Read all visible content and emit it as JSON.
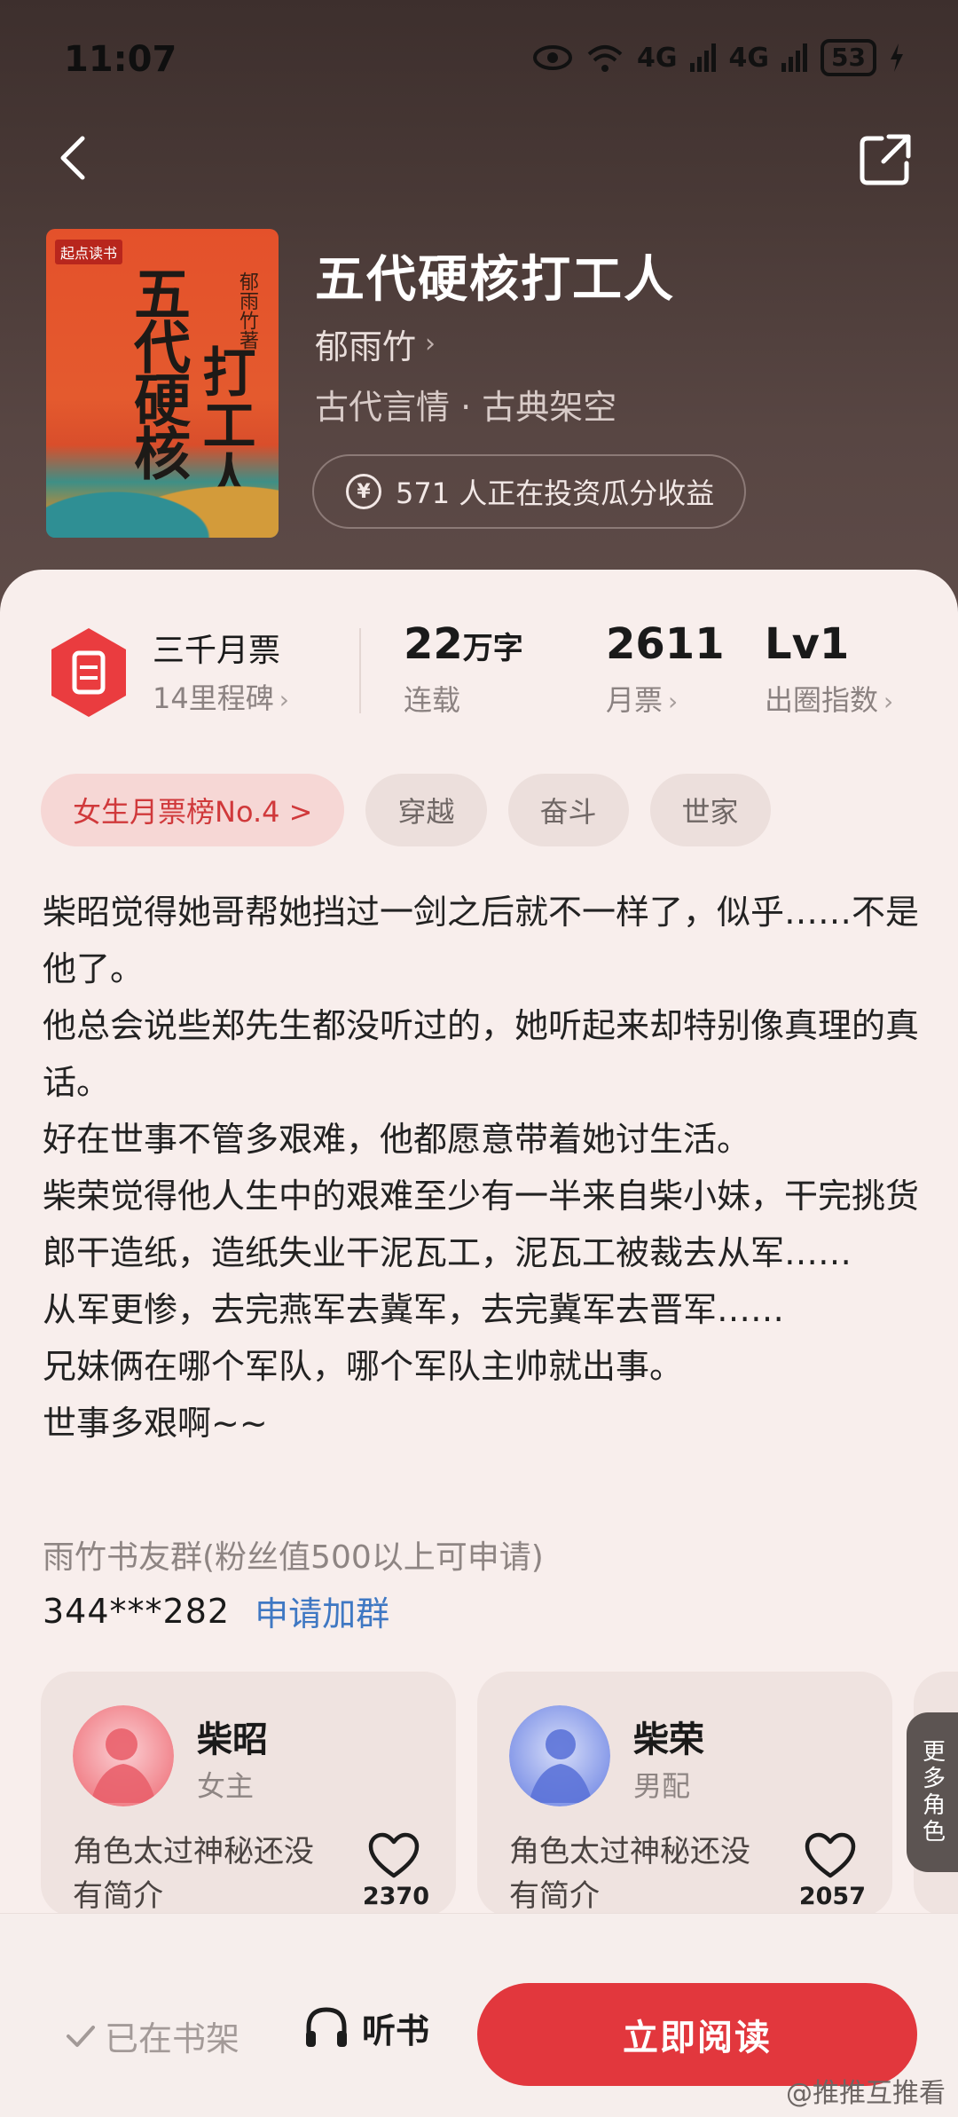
{
  "status": {
    "time": "11:07",
    "battery": "53",
    "net1": "4G",
    "net2": "4G"
  },
  "book": {
    "title": "五代硬核打工人",
    "author": "郁雨竹",
    "genre": "古代言情 · 古典架空",
    "invest": "571 人正在投资瓜分收益",
    "cover": {
      "title_a": "五代硬核",
      "title_b": "打工人",
      "author": "郁雨竹著",
      "brand": "起点读书"
    }
  },
  "stats": {
    "ticket_title": "三千月票",
    "ticket_sub": "14里程碑",
    "words_value": "22",
    "words_unit": "万字",
    "words_label": "连载",
    "votes_value": "2611",
    "votes_label": "月票",
    "level_value": "Lv1",
    "level_label": "出圈指数"
  },
  "tags": [
    "女生月票榜No.4 >",
    "穿越",
    "奋斗",
    "世家"
  ],
  "synopsis": [
    "柴昭觉得她哥帮她挡过一剑之后就不一样了，似乎……不是他了。",
    "他总会说些郑先生都没听过的，她听起来却特别像真理的真话。",
    "好在世事不管多艰难，他都愿意带着她讨生活。",
    "柴荣觉得他人生中的艰难至少有一半来自柴小妹，干完挑货郎干造纸，造纸失业干泥瓦工，泥瓦工被裁去从军……",
    "从军更惨，去完燕军去冀军，去完冀军去晋军……",
    "兄妹俩在哪个军队，哪个军队主帅就出事。",
    "世事多艰啊~~"
  ],
  "group": {
    "label": "雨竹书友群(粉丝值500以上可申请)",
    "number": "344***282",
    "apply": "申请加群"
  },
  "roles": [
    {
      "name": "柴昭",
      "type": "女主",
      "desc": "角色太过神秘还没有简介",
      "likes": "2370",
      "color": "#f07a82"
    },
    {
      "name": "柴荣",
      "type": "男配",
      "desc": "角色太过神秘还没有简介",
      "likes": "2057",
      "color": "#7a8fe6"
    }
  ],
  "more_roles": "更多角色",
  "bottom": {
    "onshelf": "已在书架",
    "listen": "听书",
    "read": "立即阅读"
  },
  "watermark": "@推推互推看",
  "colors": {
    "accent": "#e2373d",
    "link": "#3f78c3",
    "tag_rank_bg": "#f6d7d5"
  }
}
